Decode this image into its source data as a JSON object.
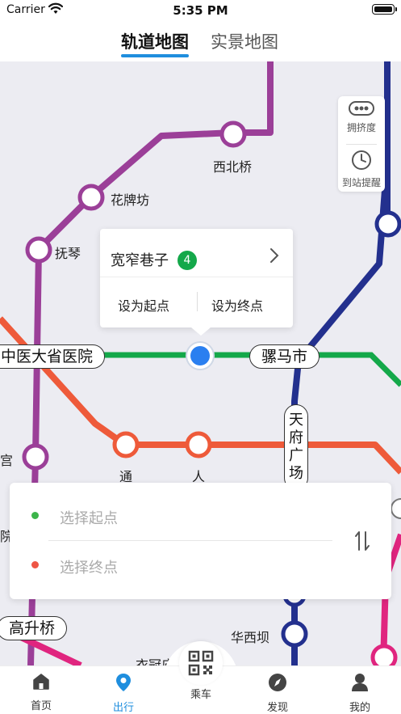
{
  "status_bar": {
    "carrier": "Carrier",
    "time": "5:35 PM"
  },
  "top_tabs": {
    "rail_map": "轨道地图",
    "real_map": "实景地图"
  },
  "map": {
    "stations": {
      "xibeiqiao": "西北桥",
      "huapaifang": "花牌坊",
      "fuqin": "抚琴",
      "zhongyi": "中医大省医院",
      "luomashi": "骡马市",
      "tianfu_guangchang": [
        "天",
        "府",
        "广",
        "场"
      ],
      "wenshu_partial": "宫",
      "tong_partial": "通",
      "ren_partial": "人",
      "gongyuan_partial": "院",
      "gaoshengqiao": "高升桥",
      "huaxiba": "华西坝",
      "yiguanmiao": "衣冠庙"
    },
    "line_colors": {
      "line4": "#14a84a",
      "line2": "#ee5a3a",
      "line1": "#23308e",
      "line5": "#9b3f98",
      "line3": "#e0257f"
    }
  },
  "tools": {
    "crowd_label": "拥挤度",
    "remind_label": "到站提醒"
  },
  "popup": {
    "station_name": "宽窄巷子",
    "line_number": "4",
    "set_start": "设为起点",
    "set_end": "设为终点"
  },
  "route": {
    "start_placeholder": "选择起点",
    "end_placeholder": "选择终点"
  },
  "bottom_nav": {
    "home": "首页",
    "travel": "出行",
    "ride": "乘车",
    "discover": "发现",
    "mine": "我的"
  }
}
